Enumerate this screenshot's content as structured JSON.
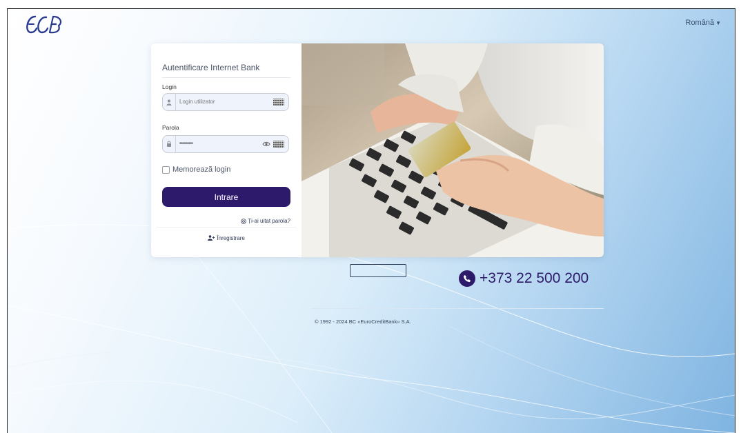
{
  "header": {
    "logo_text": "ECB",
    "language": "Română"
  },
  "login_form": {
    "title": "Autentificare Internet Bank",
    "login_label": "Login",
    "login_placeholder": "Login utilizator",
    "password_label": "Parola",
    "password_value": "••••••••••",
    "remember_label": "Memorează login",
    "submit_label": "Intrare",
    "forgot_label": "Ți-ai uitat parola?",
    "register_label": "Înregistrare"
  },
  "contact": {
    "phone": "+373 22 500 200"
  },
  "footer": {
    "copyright": "© 1992 - 2024 BC «EuroCreditBank» S.A."
  },
  "colors": {
    "primary": "#2e1a6b",
    "background_start": "#ffffff",
    "background_end": "#7fb4e1"
  },
  "icons": [
    "user-icon",
    "keyboard-icon",
    "lock-icon",
    "eye-icon",
    "help-circle-icon",
    "user-plus-icon",
    "phone-icon",
    "chevron-down-icon"
  ]
}
